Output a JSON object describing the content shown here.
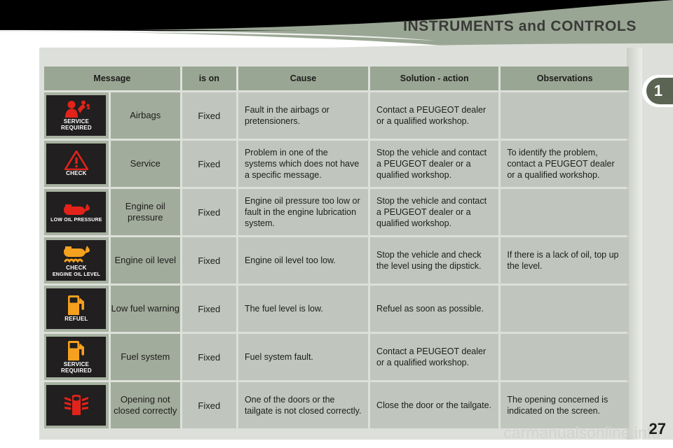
{
  "header": {
    "title": "INSTRUMENTS and CONTROLS",
    "chapter_tab": "1",
    "title_color": "#3a3a38",
    "band_color": "#9aa694"
  },
  "table": {
    "columns": [
      "Message",
      "is on",
      "Cause",
      "Solution - action",
      "Observations"
    ],
    "rows": [
      {
        "lamp": {
          "icon": "airbag-occupant-icon",
          "color": "#e2231a",
          "caption_line1": "SERVICE",
          "caption_line2": "REQUIRED"
        },
        "message": "Airbags",
        "is_on": "Fixed",
        "cause": "Fault in the airbags or pretensioners.",
        "solution": "Contact a PEUGEOT dealer or a qualified workshop.",
        "observations": ""
      },
      {
        "lamp": {
          "icon": "warning-triangle-icon",
          "color": "#e2231a",
          "caption_line1": "CHECK",
          "caption_line2": ""
        },
        "message": "Service",
        "is_on": "Fixed",
        "cause": "Problem in one of the systems which does not have a specific message.",
        "solution": "Stop the vehicle and contact a PEUGEOT dealer or a qualified workshop.",
        "observations": "To identify the problem, contact a PEUGEOT dealer or a qualified workshop."
      },
      {
        "lamp": {
          "icon": "oil-can-icon",
          "color": "#e2231a",
          "caption_line1": "LOW OIL PRESSURE",
          "caption_line2": ""
        },
        "message": "Engine oil pressure",
        "is_on": "Fixed",
        "cause": "Engine oil pressure too low or fault in the engine lubrication system.",
        "solution": "Stop the vehicle and contact a PEUGEOT dealer or a qualified workshop.",
        "observations": ""
      },
      {
        "lamp": {
          "icon": "oil-can-level-icon",
          "color": "#f5a01e",
          "caption_line1": "CHECK",
          "caption_line2": "ENGINE OIL LEVEL"
        },
        "message": "Engine oil level",
        "is_on": "Fixed",
        "cause": "Engine oil level too low.",
        "solution": "Stop the vehicle and check the level using the dipstick.",
        "observations": "If there is a lack of oil, top up the level."
      },
      {
        "lamp": {
          "icon": "fuel-pump-icon",
          "color": "#f5a01e",
          "caption_line1": "REFUEL",
          "caption_line2": ""
        },
        "message": "Low fuel warning",
        "is_on": "Fixed",
        "cause": "The fuel level is low.",
        "solution": "Refuel as soon as possible.",
        "observations": ""
      },
      {
        "lamp": {
          "icon": "fuel-pump-icon",
          "color": "#f5a01e",
          "caption_line1": "SERVICE",
          "caption_line2": "REQUIRED"
        },
        "message": "Fuel system",
        "is_on": "Fixed",
        "cause": "Fuel system fault.",
        "solution": "Contact a PEUGEOT dealer or a qualified workshop.",
        "observations": ""
      },
      {
        "lamp": {
          "icon": "doors-open-icon",
          "color": "#e2231a",
          "caption_line1": "",
          "caption_line2": ""
        },
        "message": "Opening not closed correctly",
        "is_on": "Fixed",
        "cause": "One of the doors or the tailgate is not closed correctly.",
        "solution": "Close the door or the tailgate.",
        "observations": "The opening concerned is indicated on the screen."
      }
    ]
  },
  "footer": {
    "watermark": "carmanualsonline.info",
    "page_number": "27"
  }
}
